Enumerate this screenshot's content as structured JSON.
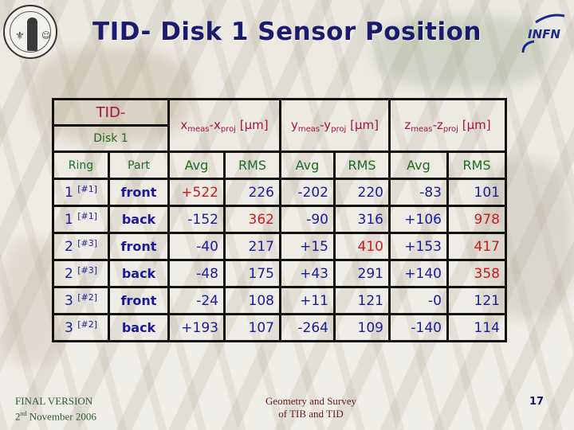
{
  "slide": {
    "title": "TID- Disk 1 Sensor Position",
    "logo_left": "University of Florence seal",
    "logo_right": "INFN",
    "footer_left_line1": "FINAL VERSION",
    "footer_left_day": "2",
    "footer_left_day_suffix": "nd",
    "footer_left_rest": " November 2006",
    "footer_center_line1": "Geometry and Survey",
    "footer_center_line2": "of TIB and TID",
    "page_number": "17"
  },
  "table": {
    "corner_line1": "TID-",
    "corner_line2": "Disk 1",
    "groups": [
      {
        "var": "x",
        "sub_meas": "meas",
        "sub_proj": "proj",
        "unit": "[µm]"
      },
      {
        "var": "y",
        "sub_meas": "meas",
        "sub_proj": "proj",
        "unit": "[µm]"
      },
      {
        "var": "z",
        "sub_meas": "meas",
        "sub_proj": "proj",
        "unit": "[µm]"
      }
    ],
    "columns": [
      "Ring",
      "Part",
      "Avg",
      "RMS",
      "Avg",
      "RMS",
      "Avg",
      "RMS"
    ],
    "highlight_color": "#cc1a1a",
    "text_color": "#1a1aa0",
    "rows": [
      {
        "ring": "1",
        "tag": "[#1]",
        "part": "front",
        "x_avg": "+522",
        "x_rms": "226",
        "y_avg": "-202",
        "y_rms": "220",
        "z_avg": "-83",
        "z_rms": "101",
        "hl": [
          "x_avg"
        ]
      },
      {
        "ring": "1",
        "tag": "[#1]",
        "part": "back",
        "x_avg": "-152",
        "x_rms": "362",
        "y_avg": "-90",
        "y_rms": "316",
        "z_avg": "+106",
        "z_rms": "978",
        "hl": [
          "x_rms",
          "z_rms"
        ]
      },
      {
        "ring": "2",
        "tag": "[#3]",
        "part": "front",
        "x_avg": "-40",
        "x_rms": "217",
        "y_avg": "+15",
        "y_rms": "410",
        "z_avg": "+153",
        "z_rms": "417",
        "hl": [
          "y_rms",
          "z_rms"
        ]
      },
      {
        "ring": "2",
        "tag": "[#3]",
        "part": "back",
        "x_avg": "-48",
        "x_rms": "175",
        "y_avg": "+43",
        "y_rms": "291",
        "z_avg": "+140",
        "z_rms": "358",
        "hl": [
          "z_rms"
        ]
      },
      {
        "ring": "3",
        "tag": "[#2]",
        "part": "front",
        "x_avg": "-24",
        "x_rms": "108",
        "y_avg": "+11",
        "y_rms": "121",
        "z_avg": "-0",
        "z_rms": "121",
        "hl": []
      },
      {
        "ring": "3",
        "tag": "[#2]",
        "part": "back",
        "x_avg": "+193",
        "x_rms": "107",
        "y_avg": "-264",
        "y_rms": "109",
        "z_avg": "-140",
        "z_rms": "114",
        "hl": []
      }
    ]
  }
}
